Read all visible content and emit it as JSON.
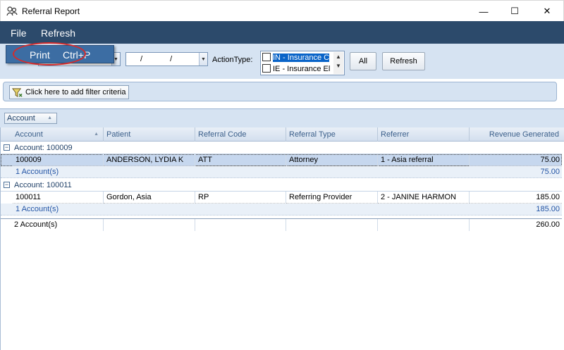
{
  "window": {
    "title": "Referral Report",
    "minimize_glyph": "—",
    "maximize_glyph": "☐",
    "close_glyph": "✕"
  },
  "menubar": {
    "file_label": "File",
    "refresh_label": "Refresh"
  },
  "file_menu": {
    "print_label": "Print",
    "print_shortcut": "Ctrl+P"
  },
  "toolbar": {
    "start_date": "",
    "end_date": "/ /",
    "action_type_label": "ActionType:",
    "action_options": [
      "IN - Insurance C",
      "IE - Insurance El"
    ],
    "all_button": "All",
    "refresh_button": "Refresh"
  },
  "filter": {
    "add_filter_label": "Click here to add filter criteria"
  },
  "grouping": {
    "group_chip_label": "Account"
  },
  "grid": {
    "columns": [
      "Account",
      "Patient",
      "Referral Code",
      "Referral Type",
      "Referrer",
      "Revenue Generated"
    ],
    "groups": [
      {
        "label": "Account:  100009",
        "rows": [
          {
            "account": "100009",
            "patient": "ANDERSON, LYDIA K",
            "code": "ATT",
            "type": "Attorney",
            "referrer": "1 - Asia referral",
            "revenue": "75.00"
          }
        ],
        "summary_count": "1 Account(s)",
        "summary_revenue": "75.00"
      },
      {
        "label": "Account:  100011",
        "rows": [
          {
            "account": "100011",
            "patient": "Gordon, Asia",
            "code": "RP",
            "type": "Referring Provider",
            "referrer": "2 - JANINE HARMON",
            "revenue": "185.00"
          }
        ],
        "summary_count": "1 Account(s)",
        "summary_revenue": "185.00"
      }
    ],
    "total_count": "2 Account(s)",
    "total_revenue": "260.00"
  },
  "colors": {
    "menubar": "#2c4a6b",
    "toolbar": "#d6e3f2",
    "menu_highlight": "#3c6da3",
    "annotation": "#d62b2b"
  }
}
